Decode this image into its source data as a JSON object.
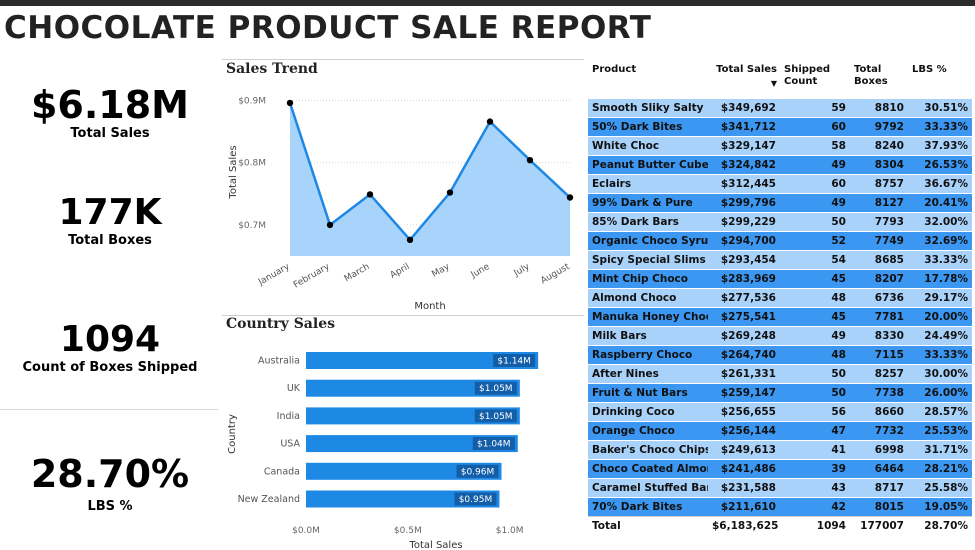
{
  "report": {
    "title": "CHOCOLATE PRODUCT SALE REPORT"
  },
  "kpis": [
    {
      "value": "$6.18M",
      "label": "Total Sales"
    },
    {
      "value": "177K",
      "label": "Total Boxes"
    },
    {
      "value": "1094",
      "label": "Count of Boxes Shipped"
    },
    {
      "value": "28.70%",
      "label": "LBS %"
    }
  ],
  "sales_trend": {
    "title": "Sales Trend",
    "xlabel": "Month",
    "ylabel": "Total Sales",
    "yticks": [
      "$0.9M",
      "$0.8M",
      "$0.7M"
    ]
  },
  "country_sales": {
    "title": "Country Sales",
    "xlabel": "Total Sales",
    "ylabel": "Country",
    "xticks": [
      "$0.0M",
      "$0.5M",
      "$1.0M"
    ]
  },
  "chart_data": [
    {
      "type": "area",
      "title": "Sales Trend",
      "xlabel": "Month",
      "ylabel": "Total Sales",
      "categories": [
        "January",
        "February",
        "March",
        "April",
        "May",
        "June",
        "July",
        "August"
      ],
      "values": [
        0.896,
        0.7,
        0.749,
        0.676,
        0.752,
        0.866,
        0.804,
        0.744
      ],
      "ylim": [
        0.65,
        0.92
      ],
      "unit": "$M",
      "grid": true,
      "colors": {
        "line": "#1e88e5",
        "fill": "#a8d3fb",
        "marker": "#000000"
      }
    },
    {
      "type": "bar",
      "orientation": "horizontal",
      "title": "Country Sales",
      "xlabel": "Total Sales",
      "ylabel": "Country",
      "categories": [
        "Australia",
        "UK",
        "India",
        "USA",
        "Canada",
        "New Zealand"
      ],
      "values": [
        1.14,
        1.05,
        1.05,
        1.04,
        0.96,
        0.95
      ],
      "labels": [
        "$1.14M",
        "$1.05M",
        "$1.05M",
        "$1.04M",
        "$0.96M",
        "$0.95M"
      ],
      "xlim": [
        0,
        1.1
      ],
      "unit": "$M",
      "colors": {
        "bar": "#1e88e5",
        "label_bg": "#125ea8"
      }
    }
  ],
  "table": {
    "columns": [
      "Product",
      "Total Sales",
      "Shipped Count",
      "Total Boxes",
      "LBS %"
    ],
    "sort_indicator": "▼",
    "rows": [
      [
        "Smooth Sliky Salty",
        "$349,692",
        "59",
        "8810",
        "30.51%"
      ],
      [
        "50% Dark Bites",
        "$341,712",
        "60",
        "9792",
        "33.33%"
      ],
      [
        "White Choc",
        "$329,147",
        "58",
        "8240",
        "37.93%"
      ],
      [
        "Peanut Butter Cubes",
        "$324,842",
        "49",
        "8304",
        "26.53%"
      ],
      [
        "Eclairs",
        "$312,445",
        "60",
        "8757",
        "36.67%"
      ],
      [
        "99% Dark & Pure",
        "$299,796",
        "49",
        "8127",
        "20.41%"
      ],
      [
        "85% Dark Bars",
        "$299,229",
        "50",
        "7793",
        "32.00%"
      ],
      [
        "Organic Choco Syrup",
        "$294,700",
        "52",
        "7749",
        "32.69%"
      ],
      [
        "Spicy Special Slims",
        "$293,454",
        "54",
        "8685",
        "33.33%"
      ],
      [
        "Mint Chip Choco",
        "$283,969",
        "45",
        "8207",
        "17.78%"
      ],
      [
        "Almond Choco",
        "$277,536",
        "48",
        "6736",
        "29.17%"
      ],
      [
        "Manuka Honey Choco",
        "$275,541",
        "45",
        "7781",
        "20.00%"
      ],
      [
        "Milk Bars",
        "$269,248",
        "49",
        "8330",
        "24.49%"
      ],
      [
        "Raspberry Choco",
        "$264,740",
        "48",
        "7115",
        "33.33%"
      ],
      [
        "After Nines",
        "$261,331",
        "50",
        "8257",
        "30.00%"
      ],
      [
        "Fruit & Nut Bars",
        "$259,147",
        "50",
        "7738",
        "26.00%"
      ],
      [
        "Drinking Coco",
        "$256,655",
        "56",
        "8660",
        "28.57%"
      ],
      [
        "Orange Choco",
        "$256,144",
        "47",
        "7732",
        "25.53%"
      ],
      [
        "Baker's Choco Chips",
        "$249,613",
        "41",
        "6998",
        "31.71%"
      ],
      [
        "Choco Coated Almonds",
        "$241,486",
        "39",
        "6464",
        "28.21%"
      ],
      [
        "Caramel Stuffed Bars",
        "$231,588",
        "43",
        "8717",
        "25.58%"
      ],
      [
        "70% Dark Bites",
        "$211,610",
        "42",
        "8015",
        "19.05%"
      ]
    ],
    "total": [
      "Total",
      "$6,183,625",
      "1094",
      "177007",
      "28.70%"
    ]
  }
}
